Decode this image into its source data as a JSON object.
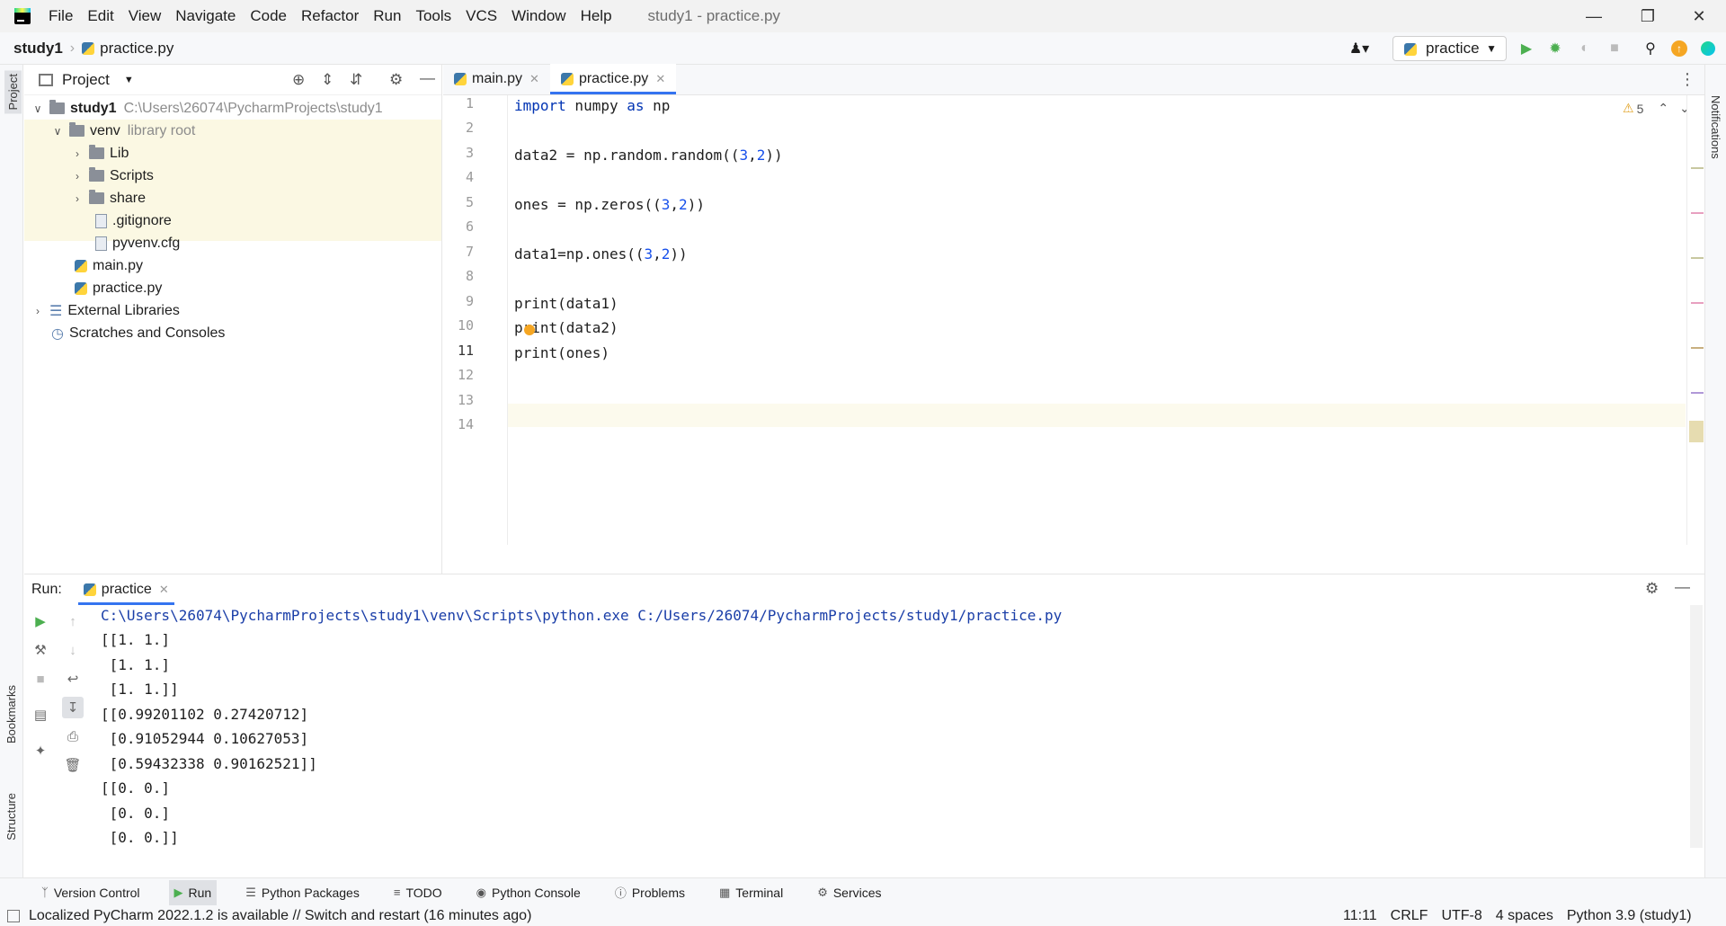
{
  "window": {
    "title": "study1 - practice.py",
    "menu": [
      "File",
      "Edit",
      "View",
      "Navigate",
      "Code",
      "Refactor",
      "Run",
      "Tools",
      "VCS",
      "Window",
      "Help"
    ]
  },
  "breadcrumb": {
    "project": "study1",
    "file": "practice.py"
  },
  "run_config": {
    "name": "practice"
  },
  "project_panel": {
    "title": "Project",
    "tree": {
      "root": {
        "name": "study1",
        "path": "C:\\Users\\26074\\PycharmProjects\\study1"
      },
      "venv": {
        "name": "venv",
        "hint": "library root"
      },
      "lib": "Lib",
      "scripts": "Scripts",
      "share": "share",
      "gitignore": ".gitignore",
      "pyvenv": "pyvenv.cfg",
      "main": "main.py",
      "practice": "practice.py",
      "external": "External Libraries",
      "scratches": "Scratches and Consoles"
    }
  },
  "left_stripe": {
    "project": "Project",
    "bookmarks": "Bookmarks",
    "structure": "Structure"
  },
  "right_stripe": {
    "notifications": "Notifications"
  },
  "editor": {
    "tabs": [
      "main.py",
      "practice.py"
    ],
    "warnings": "5",
    "line_numbers": [
      "1",
      "2",
      "3",
      "4",
      "5",
      "6",
      "7",
      "8",
      "9",
      "10",
      "11",
      "12",
      "13",
      "14"
    ],
    "code": {
      "l1_kw": "import",
      "l1_rest": " numpy ",
      "l1_as": "as",
      "l1_np": " np",
      "l3": "data2 = np.random.random((",
      "l3_a": "3",
      "l3_sep": ",",
      "l3_b": "2",
      "l3_end": "))",
      "l5": "ones = np.zeros((",
      "l5_a": "3",
      "l5_sep": ",",
      "l5_b": "2",
      "l5_end": "))",
      "l7": "data1=np.ones((",
      "l7_a": "3",
      "l7_sep": ",",
      "l7_b": "2",
      "l7_end": "))",
      "l9": "print(data1)",
      "l10": "print(data2)",
      "l11": "print(ones)"
    }
  },
  "run_panel": {
    "label": "Run:",
    "tab": "practice",
    "output": [
      "C:\\Users\\26074\\PycharmProjects\\study1\\venv\\Scripts\\python.exe C:/Users/26074/PycharmProjects/study1/practice.py",
      "[[1. 1.]",
      " [1. 1.]",
      " [1. 1.]]",
      "[[0.99201102 0.27420712]",
      " [0.91052944 0.10627053]",
      " [0.59432338 0.90162521]]",
      "[[0. 0.]",
      " [0. 0.]",
      " [0. 0.]]"
    ]
  },
  "tool_windows": [
    "Version Control",
    "Run",
    "Python Packages",
    "TODO",
    "Python Console",
    "Problems",
    "Terminal",
    "Services"
  ],
  "status": {
    "message": "Localized PyCharm 2022.1.2 is available // Switch and restart (16 minutes ago)",
    "position": "11:11",
    "line_sep": "CRLF",
    "encoding": "UTF-8",
    "indent": "4 spaces",
    "interpreter": "Python 3.9 (study1)"
  },
  "colors": {
    "accent": "#3574f0",
    "keyword": "#0033b3",
    "number": "#1750eb",
    "run_green": "#4caf50"
  }
}
